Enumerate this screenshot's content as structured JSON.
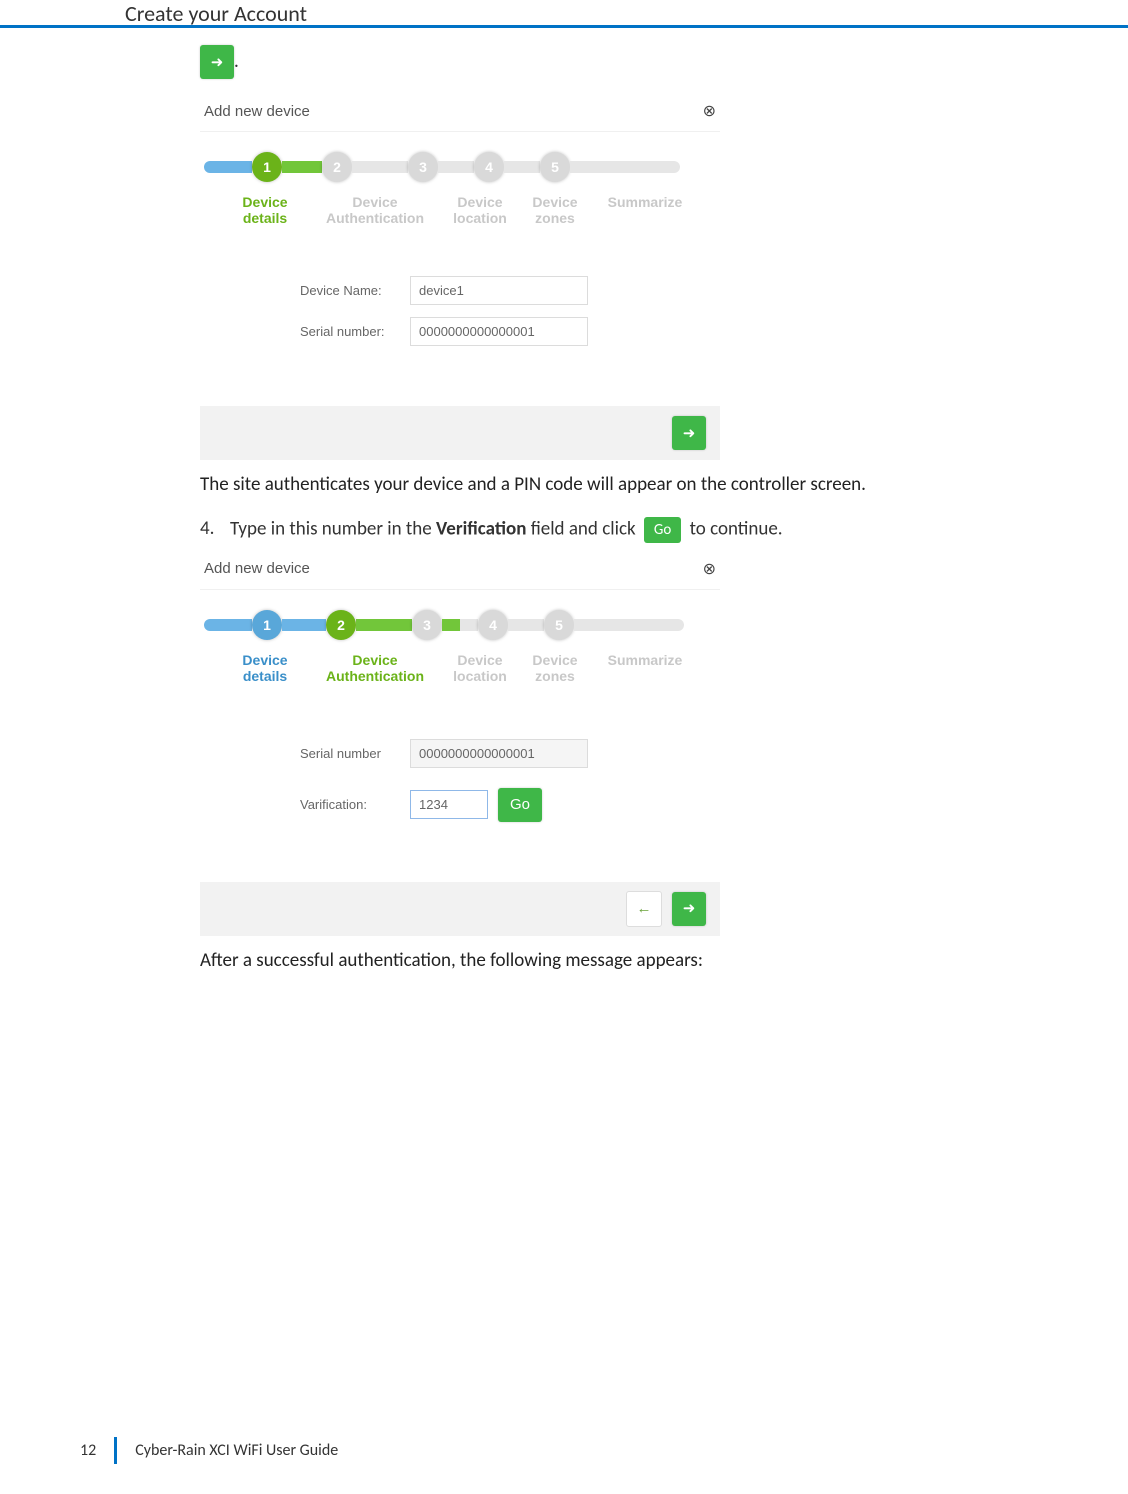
{
  "page": {
    "title": "Create your Account",
    "pageNumber": "12",
    "footerTitle": "Cyber-Rain XCI WiFi User Guide"
  },
  "wizard": {
    "dialogTitle": "Add new device",
    "steps": [
      {
        "num": "1",
        "label_line1": "Device",
        "label_line2": "details"
      },
      {
        "num": "2",
        "label_line1": "Device",
        "label_line2": "Authentication"
      },
      {
        "num": "3",
        "label_line1": "Device",
        "label_line2": "location"
      },
      {
        "num": "4",
        "label_line1": "Device",
        "label_line2": "zones"
      },
      {
        "num": "5",
        "label_line1": "Summarize",
        "label_line2": ""
      }
    ]
  },
  "form1": {
    "deviceNameLabel": "Device Name:",
    "deviceNameValue": "device1",
    "serialLabel": "Serial number:",
    "serialValue": "0000000000000001"
  },
  "text1": "The site authenticates your device and a PIN code will appear on the controller screen.",
  "step4": {
    "num": "4.",
    "before": "Type in this number in the ",
    "bold": "Verification",
    "mid": " field and click ",
    "goLabel": "Go",
    "after": " to continue."
  },
  "form2": {
    "serialLabel": "Serial number",
    "serialValue": "0000000000000001",
    "verifLabel": "Varification:",
    "verifValue": "1234",
    "goLabel": "Go"
  },
  "text2": "After a successful authentication, the following message appears:"
}
